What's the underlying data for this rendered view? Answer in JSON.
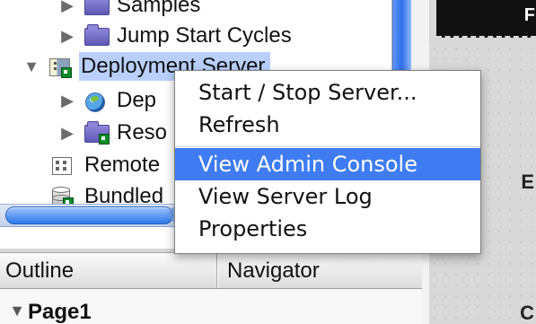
{
  "tree": {
    "items": [
      {
        "label": "Samples",
        "toggle": "▶",
        "icon": "folder-icon"
      },
      {
        "label": "Jump Start Cycles",
        "toggle": "▶",
        "icon": "folder-icon"
      },
      {
        "label": "Deployment Server",
        "toggle": "▼",
        "icon": "server-icon"
      },
      {
        "label": "Dep",
        "toggle": "▶",
        "icon": "globe-icon"
      },
      {
        "label": "Reso",
        "toggle": "▶",
        "icon": "folder-icon"
      },
      {
        "label": "Remote",
        "toggle": "",
        "icon": "remote-server-icon"
      },
      {
        "label": "Bundled",
        "toggle": "",
        "icon": "database-icon"
      }
    ]
  },
  "context_menu": {
    "items": [
      {
        "label": "Start / Stop Server..."
      },
      {
        "label": "Refresh"
      },
      {
        "label": "View Admin Console"
      },
      {
        "label": "View Server Log"
      },
      {
        "label": "Properties"
      }
    ]
  },
  "bottom_panel": {
    "tabs": [
      {
        "label": "Outline"
      },
      {
        "label": "Navigator"
      }
    ],
    "outline_item": {
      "toggle": "▼",
      "label": "Page1"
    }
  },
  "right_pane": {
    "top_letter": "F",
    "letter_1": "E",
    "letter_2": "C"
  }
}
